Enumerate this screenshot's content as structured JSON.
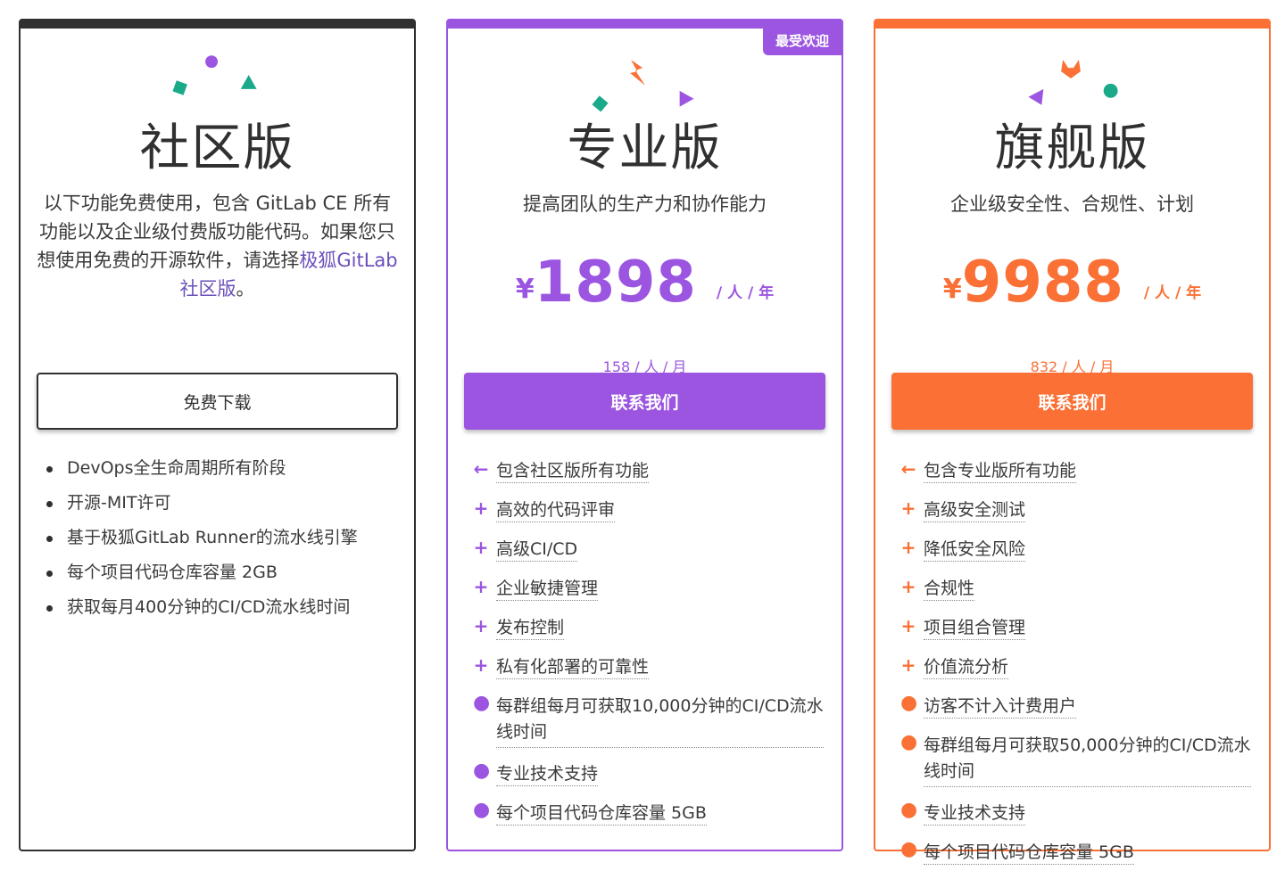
{
  "colors": {
    "dark": "#303030",
    "purple": "#9b55e0",
    "orange": "#fa7035",
    "teal": "#1aaa8a"
  },
  "community": {
    "title": "社区版",
    "desc_prefix": "以下功能免费使用，包含 GitLab CE 所有功能以及企业级付费版功能代码。如果您只想使用免费的开源软件，请选择",
    "desc_link": "极狐GitLab社区版",
    "desc_suffix": "。",
    "button": "免费下载",
    "features": [
      "DevOps全生命周期所有阶段",
      "开源-MIT许可",
      "基于极狐GitLab Runner的流水线引擎",
      "每个项目代码仓库容量 2GB",
      "获取每月400分钟的CI/CD流水线时间"
    ]
  },
  "pro": {
    "badge": "最受欢迎",
    "title": "专业版",
    "tagline": "提高团队的生产力和协作能力",
    "currency": "¥",
    "price": "1898",
    "unit": "/ 人 / 年",
    "monthly": "158 / 人 / 月",
    "button": "联系我们",
    "features": [
      {
        "mark": "←",
        "text": "包含社区版所有功能"
      },
      {
        "mark": "+",
        "text": "高效的代码评审"
      },
      {
        "mark": "+",
        "text": "高级CI/CD"
      },
      {
        "mark": "+",
        "text": "企业敏捷管理"
      },
      {
        "mark": "+",
        "text": "发布控制"
      },
      {
        "mark": "+",
        "text": "私有化部署的可靠性"
      },
      {
        "mark": "●",
        "text": "每群组每月可获取10,000分钟的CI/CD流水线时间"
      },
      {
        "mark": "●",
        "text": "专业技术支持"
      },
      {
        "mark": "●",
        "text": "每个项目代码仓库容量 5GB"
      }
    ]
  },
  "ultimate": {
    "title": "旗舰版",
    "tagline": "企业级安全性、合规性、计划",
    "currency": "¥",
    "price": "9988",
    "unit": "/ 人 / 年",
    "monthly": "832 / 人 / 月",
    "button": "联系我们",
    "features": [
      {
        "mark": "←",
        "text": "包含专业版所有功能"
      },
      {
        "mark": "+",
        "text": "高级安全测试"
      },
      {
        "mark": "+",
        "text": "降低安全风险"
      },
      {
        "mark": "+",
        "text": "合规性"
      },
      {
        "mark": "+",
        "text": "项目组合管理"
      },
      {
        "mark": "+",
        "text": "价值流分析"
      },
      {
        "mark": "●",
        "text": "访客不计入计费用户"
      },
      {
        "mark": "●",
        "text": "每群组每月可获取50,000分钟的CI/CD流水线时间"
      },
      {
        "mark": "●",
        "text": "专业技术支持"
      },
      {
        "mark": "●",
        "text": "每个项目代码仓库容量 5GB"
      }
    ]
  }
}
